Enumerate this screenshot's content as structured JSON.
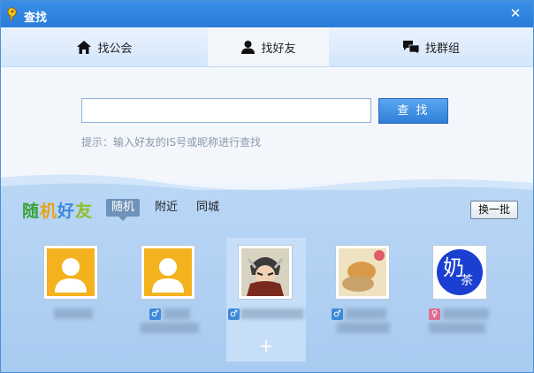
{
  "window": {
    "title": "查找",
    "close_symbol": "✕"
  },
  "tabs": [
    {
      "label": "找公会",
      "icon": "home-icon"
    },
    {
      "label": "找好友",
      "icon": "person-icon",
      "active": true
    },
    {
      "label": "找群组",
      "icon": "group-chat-icon"
    }
  ],
  "search": {
    "value": "",
    "placeholder": "",
    "button_label": "查 找",
    "hint": "提示：输入好友的IS号或昵称进行查找"
  },
  "random_friends": {
    "title_chars": [
      "随",
      "机",
      "好",
      "友"
    ],
    "filters": [
      {
        "label": "随机",
        "active": true
      },
      {
        "label": "附近"
      },
      {
        "label": "同城"
      }
    ],
    "refresh_label": "换一批",
    "add_symbol": "+",
    "friends": [
      {
        "avatar": "default-avatar",
        "gender": ""
      },
      {
        "avatar": "default-avatar",
        "gender": "male",
        "gender_symbol": "♂"
      },
      {
        "avatar": "warrior-avatar",
        "gender": "male",
        "gender_symbol": "♂"
      },
      {
        "avatar": "pet-photo-avatar",
        "gender": "male",
        "gender_symbol": "♂"
      },
      {
        "avatar": "calligraphy-avatar",
        "gender": "female",
        "gender_symbol": "♀",
        "avatar_text": "奶",
        "avatar_text2": "茶"
      }
    ]
  },
  "colors": {
    "titlebar": "#2a7cd8",
    "accent": "#3d8ad8",
    "panel": "#a8cbf1"
  }
}
